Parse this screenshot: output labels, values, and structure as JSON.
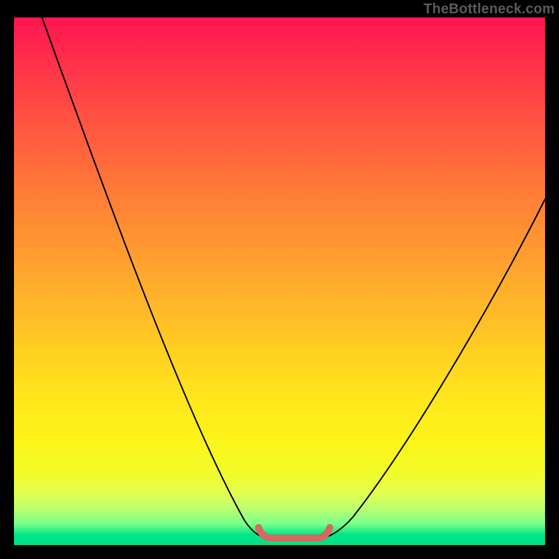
{
  "watermark": "TheBottleneck.com",
  "colors": {
    "background": "#000000",
    "gradient_top": "#ff1450",
    "gradient_bottom": "#00df86",
    "curve": "#000000",
    "marker": "#d5695f",
    "watermark": "#5b5b5b"
  },
  "chart_data": {
    "type": "line",
    "title": "",
    "xlabel": "",
    "ylabel": "",
    "xlim": [
      0,
      100
    ],
    "ylim": [
      0,
      100
    ],
    "series": [
      {
        "name": "bottleneck-curve",
        "x": [
          0,
          10,
          20,
          30,
          40,
          45,
          50,
          55,
          60,
          65,
          70,
          80,
          90,
          100
        ],
        "values": [
          100,
          80,
          60,
          40,
          20,
          5,
          2,
          2,
          2,
          5,
          15,
          35,
          55,
          70
        ]
      }
    ],
    "annotations": [
      {
        "name": "minimum-marker",
        "x_range": [
          46,
          60
        ],
        "y": 2
      }
    ],
    "grid": false,
    "legend": false
  }
}
